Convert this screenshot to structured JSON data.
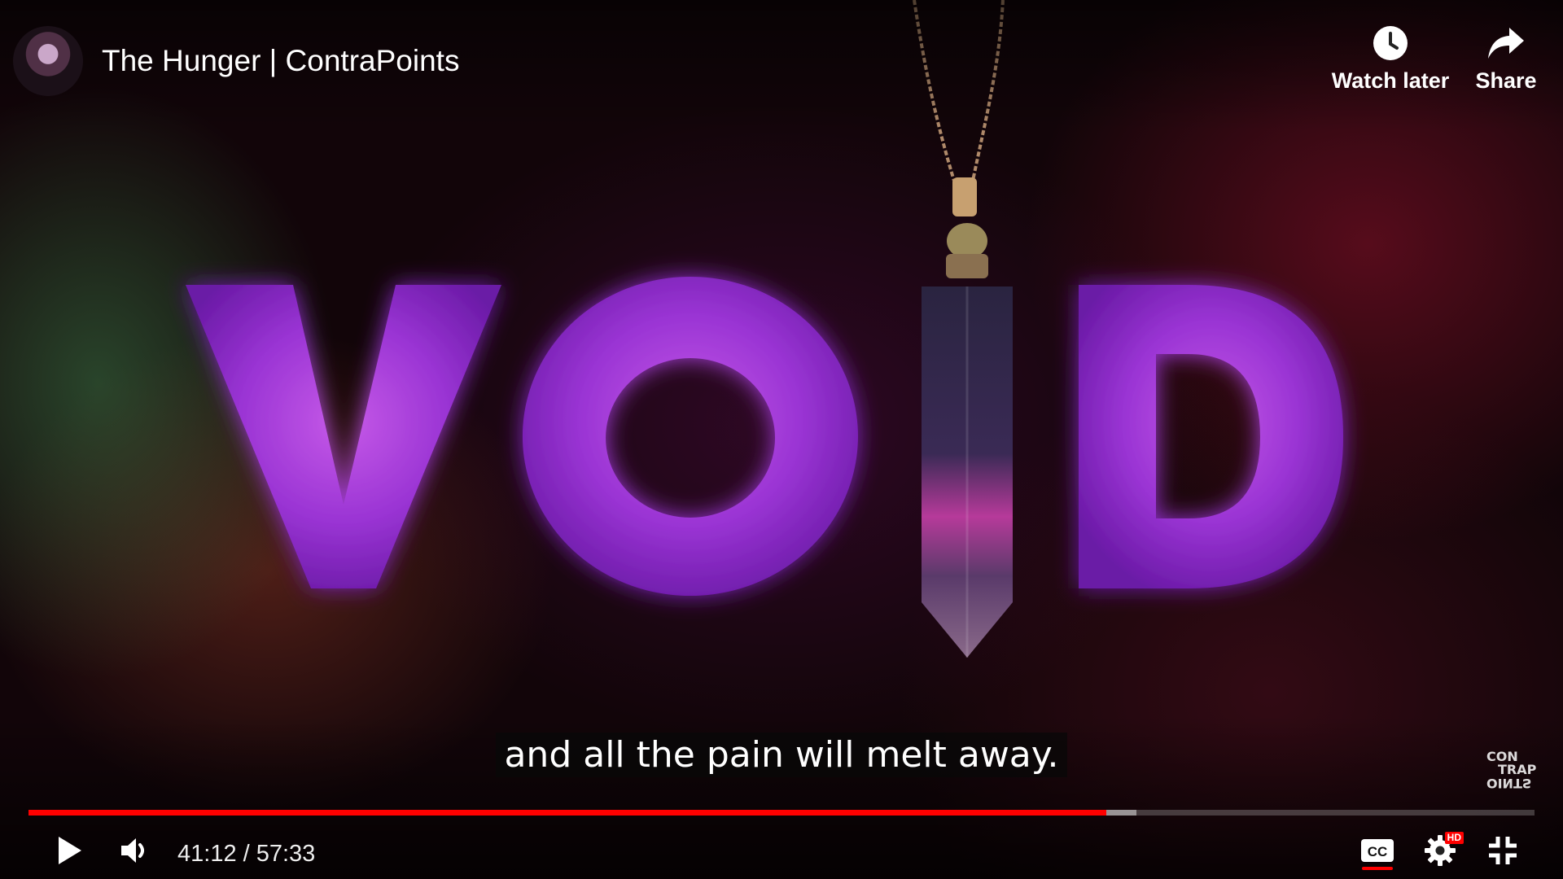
{
  "video": {
    "title": "The Hunger | ContraPoints",
    "overlay_word": "VOID",
    "subtitle": "and all the pain will melt away.",
    "watermark_lines": [
      "CON",
      "TRAP",
      "OINTS"
    ]
  },
  "top_actions": {
    "watch_later_label": "Watch later",
    "share_label": "Share"
  },
  "player": {
    "current_time": "41:12",
    "duration": "57:33",
    "time_display": "41:12 / 57:33",
    "progress_fraction": 0.7155,
    "buffered_fraction": 0.7355,
    "captions_on": true,
    "quality_badge": "HD"
  },
  "colors": {
    "progress_played": "#ff0000",
    "void_purple": "#a23ad6",
    "badge_red": "#ff0000"
  },
  "icons": [
    "clock-icon",
    "share-arrow-icon",
    "play-icon",
    "volume-icon",
    "cc-icon",
    "gear-icon",
    "exit-fullscreen-icon"
  ]
}
